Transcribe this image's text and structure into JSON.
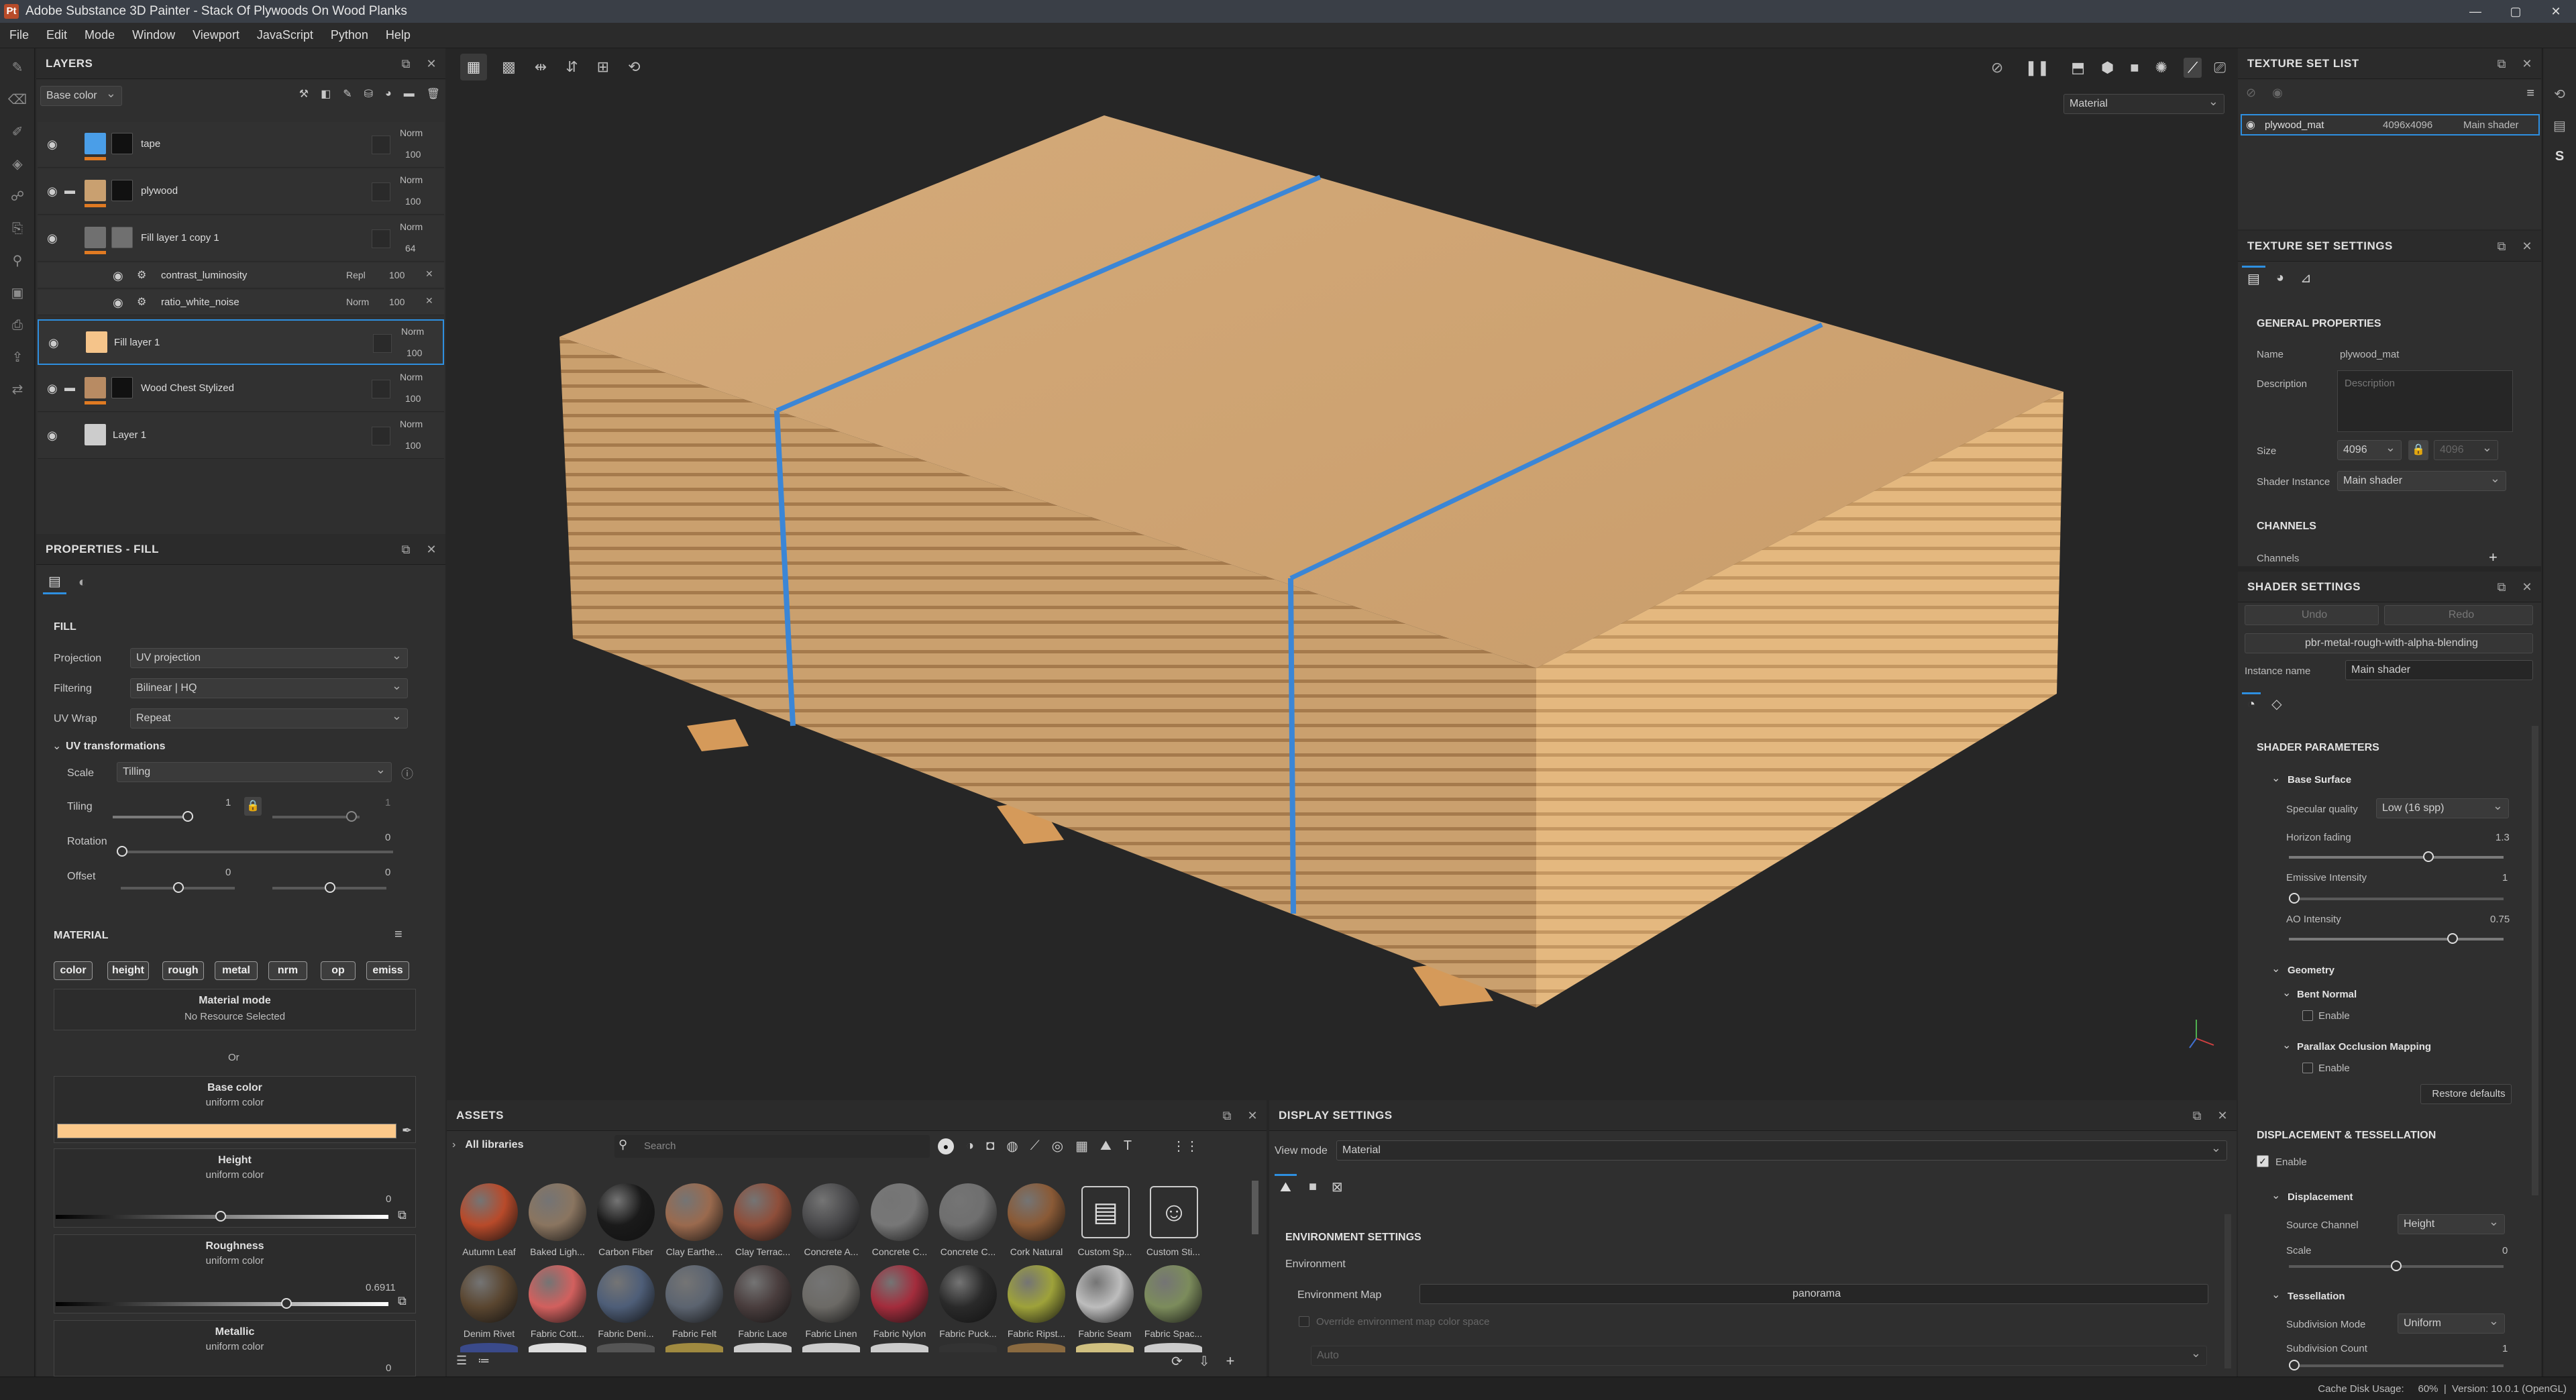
{
  "window": {
    "title": "Adobe Substance 3D Painter - Stack Of Plywoods On Wood Planks",
    "app_icon": "Pt",
    "btn_minimize": "—",
    "btn_maximize": "▢",
    "btn_close": "✕"
  },
  "menu": [
    "File",
    "Edit",
    "Mode",
    "Window",
    "Viewport",
    "JavaScript",
    "Python",
    "Help"
  ],
  "layers": {
    "title": "LAYERS",
    "channel": "Base color",
    "items": [
      {
        "name": "tape",
        "blend": "Norm",
        "opacity": "100",
        "accent": "#4a9ee8",
        "mask": "#111111",
        "bar": "#e07a22"
      },
      {
        "name": "plywood",
        "blend": "Norm",
        "opacity": "100",
        "accent": "#c9a070",
        "mask": "#111111",
        "bar": "#e07a22"
      },
      {
        "name": "Fill layer 1 copy 1",
        "blend": "Norm",
        "opacity": "64",
        "accent": "#707070",
        "mask": "#707070",
        "bar": "#e07a22"
      },
      {
        "name": "Fill layer 1",
        "blend": "Norm",
        "opacity": "100",
        "accent": "#f5c48a",
        "mask": "",
        "bar": ""
      },
      {
        "name": "Wood Chest Stylized",
        "blend": "Norm",
        "opacity": "100",
        "accent": "#b88b63",
        "mask": "#111111",
        "bar": "#e07a22"
      },
      {
        "name": "Layer 1",
        "blend": "Norm",
        "opacity": "100",
        "accent": "#cccccc",
        "mask": "",
        "bar": ""
      }
    ],
    "effects": [
      {
        "name": "contrast_luminosity",
        "blend": "Repl",
        "opacity": "100"
      },
      {
        "name": "ratio_white_noise",
        "blend": "Norm",
        "opacity": "100"
      }
    ]
  },
  "properties": {
    "title": "PROPERTIES - FILL",
    "fill_header": "FILL",
    "projection_label": "Projection",
    "projection": "UV projection",
    "filtering_label": "Filtering",
    "filtering": "Bilinear | HQ",
    "uvwrap_label": "UV Wrap",
    "uvwrap": "Repeat",
    "uvt_header": "UV transformations",
    "scale_label": "Scale",
    "scale": "Tilling",
    "tiling_label": "Tiling",
    "tiling_value": "1",
    "tiling_value2": "1",
    "rotation_label": "Rotation",
    "rotation_value": "0",
    "offset_label": "Offset",
    "offset_value1": "0",
    "offset_value2": "0",
    "material_header": "MATERIAL",
    "tags": [
      "color",
      "height",
      "rough",
      "metal",
      "nrm",
      "op",
      "emiss"
    ],
    "material_mode": "Material mode",
    "no_resource": "No Resource Selected",
    "or": "Or",
    "base_color": "Base color",
    "base_color_sub": "uniform color",
    "base_color_value": "#fcc98a",
    "height": "Height",
    "height_sub": "uniform color",
    "height_value": "0",
    "roughness": "Roughness",
    "roughness_sub": "uniform color",
    "roughness_value": "0.6911",
    "metallic": "Metallic",
    "metallic_sub": "uniform color",
    "metallic_value": "0"
  },
  "viewport": {
    "mode": "Material"
  },
  "assets": {
    "title": "ASSETS",
    "library": "All libraries",
    "search_placeholder": "Search",
    "row1": [
      {
        "name": "Autumn Leaf",
        "color": "#b84a2a"
      },
      {
        "name": "Baked Ligh...",
        "color": "#8a7560"
      },
      {
        "name": "Carbon Fiber",
        "color": "#1a1a1a"
      },
      {
        "name": "Clay Earthe...",
        "color": "#9a6a4e"
      },
      {
        "name": "Clay Terrac...",
        "color": "#8e4e3a"
      },
      {
        "name": "Concrete A...",
        "color": "#4a4a4c"
      },
      {
        "name": "Concrete C...",
        "color": "#777777"
      },
      {
        "name": "Concrete C...",
        "color": "#6f6f6f"
      },
      {
        "name": "Cork Natural",
        "color": "#8a5a36"
      },
      {
        "name": "Custom Sp...",
        "color": ""
      },
      {
        "name": "Custom Sti...",
        "color": ""
      }
    ],
    "row2": [
      {
        "name": "Denim Rivet",
        "color": "#5a4630"
      },
      {
        "name": "Fabric Cott...",
        "color": "#d2605e"
      },
      {
        "name": "Fabric Deni...",
        "color": "#4e5e78"
      },
      {
        "name": "Fabric Felt",
        "color": "#5c6470"
      },
      {
        "name": "Fabric Lace",
        "color": "#4a3e3e"
      },
      {
        "name": "Fabric Linen",
        "color": "#6c6a66"
      },
      {
        "name": "Fabric Nylon",
        "color": "#a32c3c"
      },
      {
        "name": "Fabric Puck...",
        "color": "#2a2a2a"
      },
      {
        "name": "Fabric Ripst...",
        "color": "#9ea23a"
      },
      {
        "name": "Fabric Seam",
        "color": "#bdbdbd"
      },
      {
        "name": "Fabric Spac...",
        "color": "#7c8c5c"
      }
    ]
  },
  "display": {
    "title": "DISPLAY SETTINGS",
    "view_mode_label": "View mode",
    "view_mode": "Material",
    "env_header": "ENVIRONMENT SETTINGS",
    "env_label": "Environment",
    "env_map_label": "Environment Map",
    "env_map": "panorama",
    "override_label": "Override environment map color space",
    "auto": "Auto"
  },
  "texture_set_list": {
    "title": "TEXTURE SET LIST",
    "name": "plywood_mat",
    "size": "4096x4096",
    "shader": "Main shader"
  },
  "texture_set_settings": {
    "title": "TEXTURE SET SETTINGS",
    "general": "GENERAL PROPERTIES",
    "name_label": "Name",
    "name": "plywood_mat",
    "desc_label": "Description",
    "desc_placeholder": "Description",
    "size_label": "Size",
    "size": "4096",
    "size2": "4096",
    "shader_instance_label": "Shader Instance",
    "shader_instance": "Main shader",
    "channels_header": "CHANNELS",
    "channels_label": "Channels"
  },
  "shader_settings": {
    "title": "SHADER SETTINGS",
    "undo": "Undo",
    "redo": "Redo",
    "shader": "pbr-metal-rough-with-alpha-blending",
    "instance_label": "Instance name",
    "instance": "Main shader",
    "params_header": "SHADER PARAMETERS",
    "base_surface": "Base Surface",
    "spec_label": "Specular quality",
    "spec": "Low (16 spp)",
    "horizon_label": "Horizon fading",
    "horizon": "1.3",
    "emissive_label": "Emissive Intensity",
    "emissive": "1",
    "ao_label": "AO Intensity",
    "ao": "0.75",
    "geometry": "Geometry",
    "bent_normal": "Bent Normal",
    "enable": "Enable",
    "pom": "Parallax Occlusion Mapping",
    "restore": "Restore defaults",
    "disp_header": "DISPLACEMENT & TESSELLATION",
    "disp_enable": "Enable",
    "displacement": "Displacement",
    "source_label": "Source Channel",
    "source": "Height",
    "scale_label": "Scale",
    "scale": "0",
    "tessellation": "Tessellation",
    "subdiv_mode_label": "Subdivision Mode",
    "subdiv_mode": "Uniform",
    "subdiv_count_label": "Subdivision Count",
    "subdiv_count": "1"
  },
  "status": "Cache Disk Usage:     60%  |  Version: 10.0.1 (OpenGL)"
}
